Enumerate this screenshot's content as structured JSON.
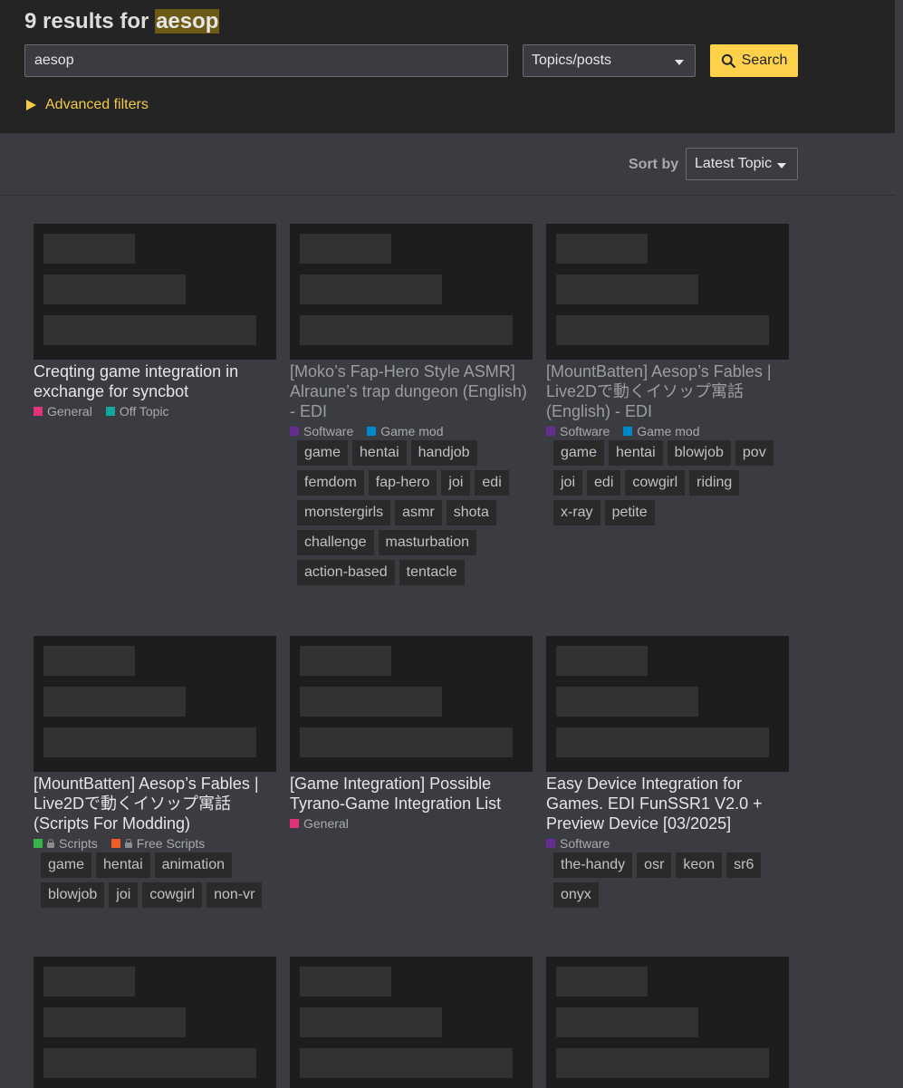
{
  "header": {
    "count_text": "9 results for",
    "query_highlight": "aesop"
  },
  "search": {
    "value": "aesop",
    "type_selected": "Topics/posts",
    "button_label": "Search",
    "advanced_filters_label": "Advanced filters"
  },
  "sort": {
    "label": "Sort by",
    "selected": "Latest Topic"
  },
  "colors": {
    "accent": "#fdd24a",
    "general": "#e0337a",
    "off_topic": "#12a89d",
    "software": "#652d90",
    "game_mod": "#0088cc",
    "scripts": "#3ab54a",
    "free_scripts": "#f15a24"
  },
  "results": [
    {
      "title": "Creqting game integration in exchange for syncbot",
      "categories": [
        {
          "name": "General",
          "color": "#e0337a",
          "locked": false
        },
        {
          "name": "Off Topic",
          "color": "#12a89d",
          "locked": false
        }
      ],
      "tags": []
    },
    {
      "title": "[Moko’s Fap-Hero Style ASMR] Alraune’s trap dungeon (English) - EDI",
      "categories": [
        {
          "name": "Software",
          "color": "#652d90",
          "locked": false
        },
        {
          "name": "Game mod",
          "color": "#0088cc",
          "locked": false
        }
      ],
      "tags": [
        "game",
        "hentai",
        "handjob",
        "femdom",
        "fap-hero",
        "joi",
        "edi",
        "monstergirls",
        "asmr",
        "shota",
        "challenge",
        "masturbation",
        "action-based",
        "tentacle"
      ]
    },
    {
      "title": "[MountBatten] Aesop’s Fables | Live2Dで動くイソップ寓話 (English) - EDI",
      "categories": [
        {
          "name": "Software",
          "color": "#652d90",
          "locked": false
        },
        {
          "name": "Game mod",
          "color": "#0088cc",
          "locked": false
        }
      ],
      "tags": [
        "game",
        "hentai",
        "blowjob",
        "pov",
        "joi",
        "edi",
        "cowgirl",
        "riding",
        "x-ray",
        "petite"
      ]
    },
    {
      "title": "[MountBatten] Aesop’s Fables | Live2Dで動くイソップ寓話 (Scripts For Modding)",
      "categories": [
        {
          "name": "Scripts",
          "color": "#3ab54a",
          "locked": true
        },
        {
          "name": "Free Scripts",
          "color": "#f15a24",
          "locked": true
        }
      ],
      "tags": [
        "game",
        "hentai",
        "animation",
        "blowjob",
        "joi",
        "cowgirl",
        "non-vr"
      ]
    },
    {
      "title": "[Game Integration] Possible Tyrano-Game Integration List",
      "categories": [
        {
          "name": "General",
          "color": "#e0337a",
          "locked": false
        }
      ],
      "tags": []
    },
    {
      "title": "Easy Device Integration for Games. EDI FunSSR1 V2.0 + Preview Device [03/2025]",
      "categories": [
        {
          "name": "Software",
          "color": "#652d90",
          "locked": false
        }
      ],
      "tags": [
        "the-handy",
        "osr",
        "keon",
        "sr6",
        "onyx"
      ]
    }
  ]
}
